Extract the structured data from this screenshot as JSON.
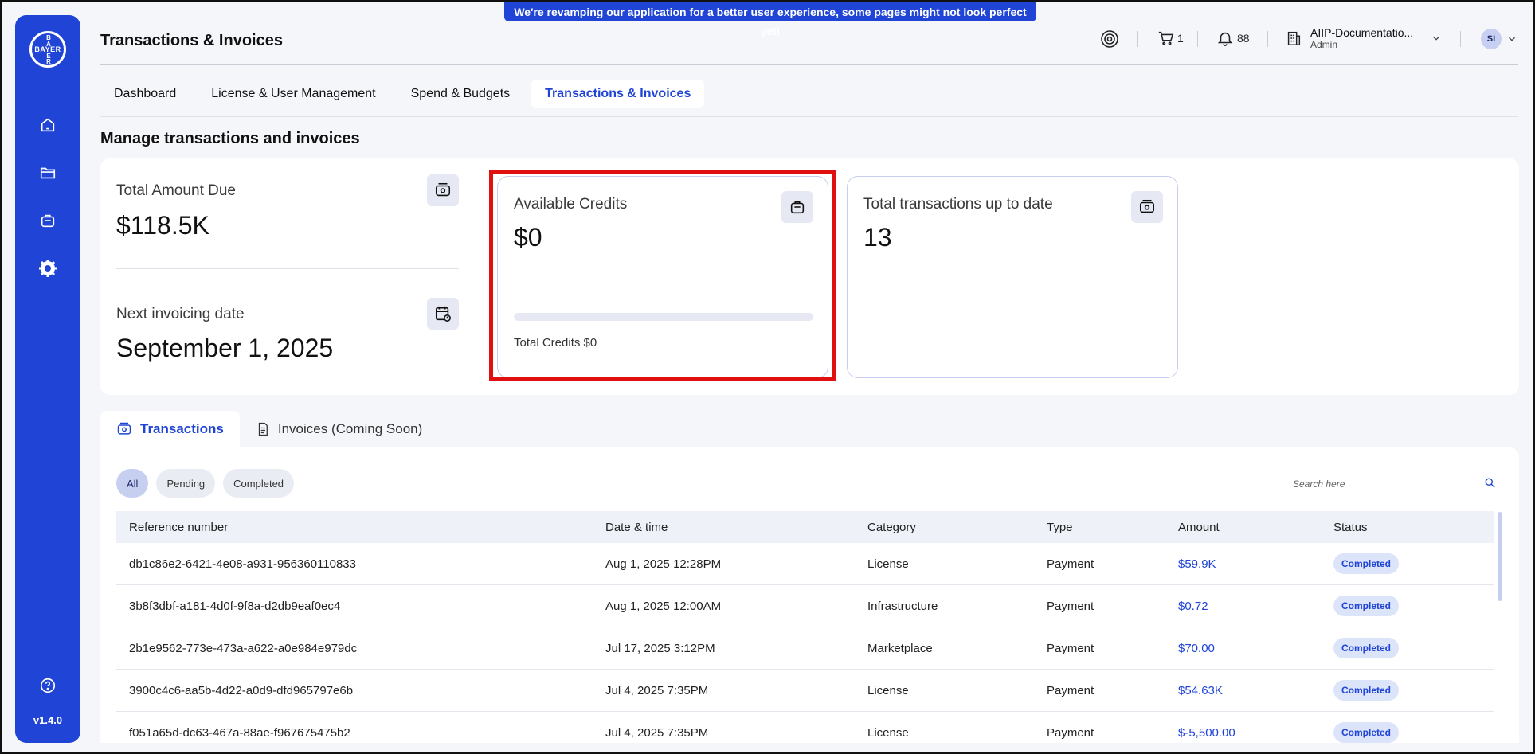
{
  "banner": {
    "text": "We're revamping our application for a better user experience, some pages might not look perfect yet!"
  },
  "sidebar": {
    "logo": {
      "horizontal": "BAYER",
      "vertical": [
        "B",
        "A",
        "Y",
        "E",
        "R"
      ]
    },
    "items": [
      {
        "name": "home-icon"
      },
      {
        "name": "folder-icon"
      },
      {
        "name": "bag-icon"
      },
      {
        "name": "gear-icon"
      }
    ],
    "help_icon": "help-circle-icon",
    "version": "v1.4.0"
  },
  "header": {
    "title": "Transactions & Invoices",
    "cart_count": "1",
    "notifications_count": "88",
    "org_name": "AIIP-Documentatio...",
    "org_role": "Admin",
    "avatar_initials": "SI"
  },
  "tabs": [
    {
      "label": "Dashboard",
      "active": false
    },
    {
      "label": "License & User Management",
      "active": false
    },
    {
      "label": "Spend & Budgets",
      "active": false
    },
    {
      "label": "Transactions & Invoices",
      "active": true
    }
  ],
  "section_title": "Manage transactions and invoices",
  "summary": {
    "total_due": {
      "label": "Total Amount Due",
      "value": "$118.5K"
    },
    "next_invoice": {
      "label": "Next invoicing date",
      "value": "September 1, 2025"
    },
    "credits": {
      "label": "Available Credits",
      "value": "$0",
      "total_label": "Total Credits $0",
      "progress": 0
    },
    "transactions": {
      "label": "Total transactions up to date",
      "value": "13"
    }
  },
  "lower_tabs": [
    {
      "label": "Transactions",
      "active": true
    },
    {
      "label": "Invoices (Coming Soon)",
      "active": false
    }
  ],
  "filters": [
    "All",
    "Pending",
    "Completed"
  ],
  "search": {
    "placeholder": "Search here"
  },
  "table": {
    "columns": [
      "Reference number",
      "Date & time",
      "Category",
      "Type",
      "Amount",
      "Status"
    ],
    "rows": [
      {
        "ref": "db1c86e2-6421-4e08-a931-956360110833",
        "date": "Aug 1, 2025 12:28PM",
        "category": "License",
        "type": "Payment",
        "amount": "$59.9K",
        "status": "Completed"
      },
      {
        "ref": "3b8f3dbf-a181-4d0f-9f8a-d2db9eaf0ec4",
        "date": "Aug 1, 2025 12:00AM",
        "category": "Infrastructure",
        "type": "Payment",
        "amount": "$0.72",
        "status": "Completed"
      },
      {
        "ref": "2b1e9562-773e-473a-a622-a0e984e979dc",
        "date": "Jul 17, 2025 3:12PM",
        "category": "Marketplace",
        "type": "Payment",
        "amount": "$70.00",
        "status": "Completed"
      },
      {
        "ref": "3900c4c6-aa5b-4d22-a0d9-dfd965797e6b",
        "date": "Jul 4, 2025 7:35PM",
        "category": "License",
        "type": "Payment",
        "amount": "$54.63K",
        "status": "Completed"
      },
      {
        "ref": "f051a65d-dc63-467a-88ae-f967675475b2",
        "date": "Jul 4, 2025 7:35PM",
        "category": "License",
        "type": "Payment",
        "amount": "$-5,500.00",
        "status": "Completed"
      }
    ]
  },
  "colors": {
    "brand": "#1f44d6",
    "highlight": "#e01010"
  }
}
